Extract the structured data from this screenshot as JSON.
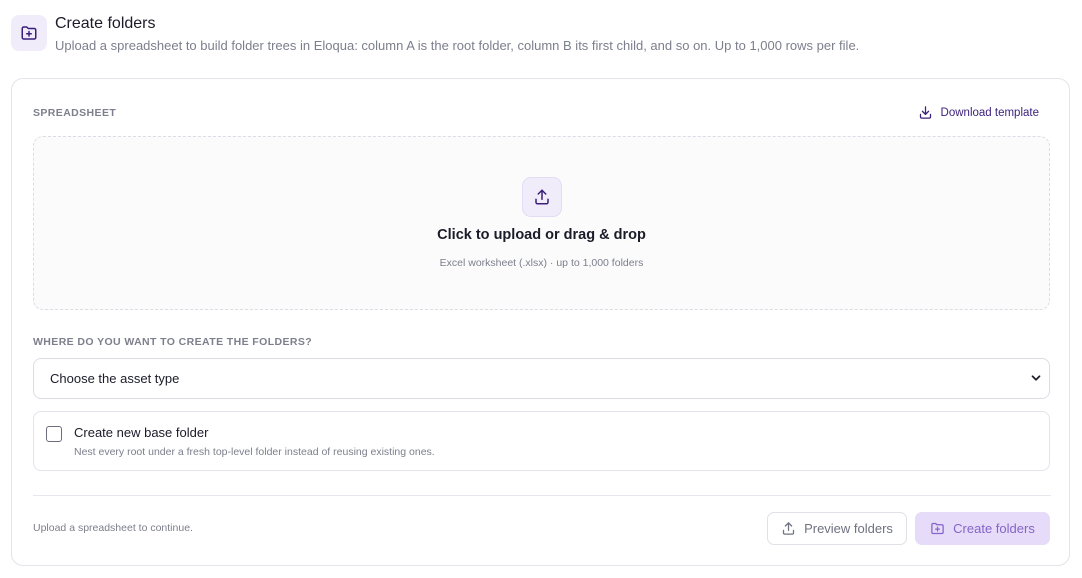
{
  "header": {
    "icon": "folder-plus-icon",
    "title": "Create folders",
    "subtitle": "Upload a spreadsheet to build folder trees in Eloqua: column A is the root folder, column B its first child, and so on. Up to 1,000 rows per file."
  },
  "spreadsheet": {
    "section_label": "SPREADSHEET",
    "download_label": "Download template",
    "download_icon": "download-icon"
  },
  "dropzone": {
    "icon": "upload-icon",
    "title": "Click to upload or drag & drop",
    "subtitle": "Excel worksheet (.xlsx) · up to 1,000 folders"
  },
  "location": {
    "section_label": "WHERE DO YOU WANT TO CREATE THE FOLDERS?",
    "select_value": "Choose the asset type",
    "select_icon": "chevron-down-icon"
  },
  "base_folder": {
    "label": "Create new base folder",
    "description": "Nest every root under a fresh top-level folder instead of reusing existing ones.",
    "checked": false
  },
  "footer": {
    "status": "Upload a spreadsheet to continue.",
    "preview_label": "Preview folders",
    "preview_icon": "upload-icon",
    "create_label": "Create folders",
    "create_icon": "folder-plus-icon"
  },
  "colors": {
    "accent": "#3b1f7a",
    "accent_light": "#f1ecfa",
    "create_button_bg": "#e6dbf8",
    "create_button_text": "#8464c8",
    "muted_text": "#7c7f8c"
  }
}
